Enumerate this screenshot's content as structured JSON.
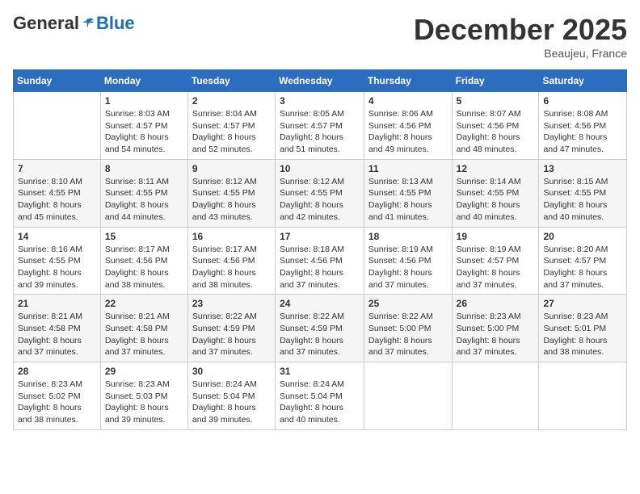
{
  "header": {
    "logo_general": "General",
    "logo_blue": "Blue",
    "month": "December 2025",
    "location": "Beaujeu, France"
  },
  "days_of_week": [
    "Sunday",
    "Monday",
    "Tuesday",
    "Wednesday",
    "Thursday",
    "Friday",
    "Saturday"
  ],
  "weeks": [
    [
      {
        "day": "",
        "sunrise": "",
        "sunset": "",
        "daylight": ""
      },
      {
        "day": "1",
        "sunrise": "Sunrise: 8:03 AM",
        "sunset": "Sunset: 4:57 PM",
        "daylight": "Daylight: 8 hours and 54 minutes."
      },
      {
        "day": "2",
        "sunrise": "Sunrise: 8:04 AM",
        "sunset": "Sunset: 4:57 PM",
        "daylight": "Daylight: 8 hours and 52 minutes."
      },
      {
        "day": "3",
        "sunrise": "Sunrise: 8:05 AM",
        "sunset": "Sunset: 4:57 PM",
        "daylight": "Daylight: 8 hours and 51 minutes."
      },
      {
        "day": "4",
        "sunrise": "Sunrise: 8:06 AM",
        "sunset": "Sunset: 4:56 PM",
        "daylight": "Daylight: 8 hours and 49 minutes."
      },
      {
        "day": "5",
        "sunrise": "Sunrise: 8:07 AM",
        "sunset": "Sunset: 4:56 PM",
        "daylight": "Daylight: 8 hours and 48 minutes."
      },
      {
        "day": "6",
        "sunrise": "Sunrise: 8:08 AM",
        "sunset": "Sunset: 4:56 PM",
        "daylight": "Daylight: 8 hours and 47 minutes."
      }
    ],
    [
      {
        "day": "7",
        "sunrise": "Sunrise: 8:10 AM",
        "sunset": "Sunset: 4:55 PM",
        "daylight": "Daylight: 8 hours and 45 minutes."
      },
      {
        "day": "8",
        "sunrise": "Sunrise: 8:11 AM",
        "sunset": "Sunset: 4:55 PM",
        "daylight": "Daylight: 8 hours and 44 minutes."
      },
      {
        "day": "9",
        "sunrise": "Sunrise: 8:12 AM",
        "sunset": "Sunset: 4:55 PM",
        "daylight": "Daylight: 8 hours and 43 minutes."
      },
      {
        "day": "10",
        "sunrise": "Sunrise: 8:12 AM",
        "sunset": "Sunset: 4:55 PM",
        "daylight": "Daylight: 8 hours and 42 minutes."
      },
      {
        "day": "11",
        "sunrise": "Sunrise: 8:13 AM",
        "sunset": "Sunset: 4:55 PM",
        "daylight": "Daylight: 8 hours and 41 minutes."
      },
      {
        "day": "12",
        "sunrise": "Sunrise: 8:14 AM",
        "sunset": "Sunset: 4:55 PM",
        "daylight": "Daylight: 8 hours and 40 minutes."
      },
      {
        "day": "13",
        "sunrise": "Sunrise: 8:15 AM",
        "sunset": "Sunset: 4:55 PM",
        "daylight": "Daylight: 8 hours and 40 minutes."
      }
    ],
    [
      {
        "day": "14",
        "sunrise": "Sunrise: 8:16 AM",
        "sunset": "Sunset: 4:55 PM",
        "daylight": "Daylight: 8 hours and 39 minutes."
      },
      {
        "day": "15",
        "sunrise": "Sunrise: 8:17 AM",
        "sunset": "Sunset: 4:56 PM",
        "daylight": "Daylight: 8 hours and 38 minutes."
      },
      {
        "day": "16",
        "sunrise": "Sunrise: 8:17 AM",
        "sunset": "Sunset: 4:56 PM",
        "daylight": "Daylight: 8 hours and 38 minutes."
      },
      {
        "day": "17",
        "sunrise": "Sunrise: 8:18 AM",
        "sunset": "Sunset: 4:56 PM",
        "daylight": "Daylight: 8 hours and 37 minutes."
      },
      {
        "day": "18",
        "sunrise": "Sunrise: 8:19 AM",
        "sunset": "Sunset: 4:56 PM",
        "daylight": "Daylight: 8 hours and 37 minutes."
      },
      {
        "day": "19",
        "sunrise": "Sunrise: 8:19 AM",
        "sunset": "Sunset: 4:57 PM",
        "daylight": "Daylight: 8 hours and 37 minutes."
      },
      {
        "day": "20",
        "sunrise": "Sunrise: 8:20 AM",
        "sunset": "Sunset: 4:57 PM",
        "daylight": "Daylight: 8 hours and 37 minutes."
      }
    ],
    [
      {
        "day": "21",
        "sunrise": "Sunrise: 8:21 AM",
        "sunset": "Sunset: 4:58 PM",
        "daylight": "Daylight: 8 hours and 37 minutes."
      },
      {
        "day": "22",
        "sunrise": "Sunrise: 8:21 AM",
        "sunset": "Sunset: 4:58 PM",
        "daylight": "Daylight: 8 hours and 37 minutes."
      },
      {
        "day": "23",
        "sunrise": "Sunrise: 8:22 AM",
        "sunset": "Sunset: 4:59 PM",
        "daylight": "Daylight: 8 hours and 37 minutes."
      },
      {
        "day": "24",
        "sunrise": "Sunrise: 8:22 AM",
        "sunset": "Sunset: 4:59 PM",
        "daylight": "Daylight: 8 hours and 37 minutes."
      },
      {
        "day": "25",
        "sunrise": "Sunrise: 8:22 AM",
        "sunset": "Sunset: 5:00 PM",
        "daylight": "Daylight: 8 hours and 37 minutes."
      },
      {
        "day": "26",
        "sunrise": "Sunrise: 8:23 AM",
        "sunset": "Sunset: 5:00 PM",
        "daylight": "Daylight: 8 hours and 37 minutes."
      },
      {
        "day": "27",
        "sunrise": "Sunrise: 8:23 AM",
        "sunset": "Sunset: 5:01 PM",
        "daylight": "Daylight: 8 hours and 38 minutes."
      }
    ],
    [
      {
        "day": "28",
        "sunrise": "Sunrise: 8:23 AM",
        "sunset": "Sunset: 5:02 PM",
        "daylight": "Daylight: 8 hours and 38 minutes."
      },
      {
        "day": "29",
        "sunrise": "Sunrise: 8:23 AM",
        "sunset": "Sunset: 5:03 PM",
        "daylight": "Daylight: 8 hours and 39 minutes."
      },
      {
        "day": "30",
        "sunrise": "Sunrise: 8:24 AM",
        "sunset": "Sunset: 5:04 PM",
        "daylight": "Daylight: 8 hours and 39 minutes."
      },
      {
        "day": "31",
        "sunrise": "Sunrise: 8:24 AM",
        "sunset": "Sunset: 5:04 PM",
        "daylight": "Daylight: 8 hours and 40 minutes."
      },
      {
        "day": "",
        "sunrise": "",
        "sunset": "",
        "daylight": ""
      },
      {
        "day": "",
        "sunrise": "",
        "sunset": "",
        "daylight": ""
      },
      {
        "day": "",
        "sunrise": "",
        "sunset": "",
        "daylight": ""
      }
    ]
  ]
}
